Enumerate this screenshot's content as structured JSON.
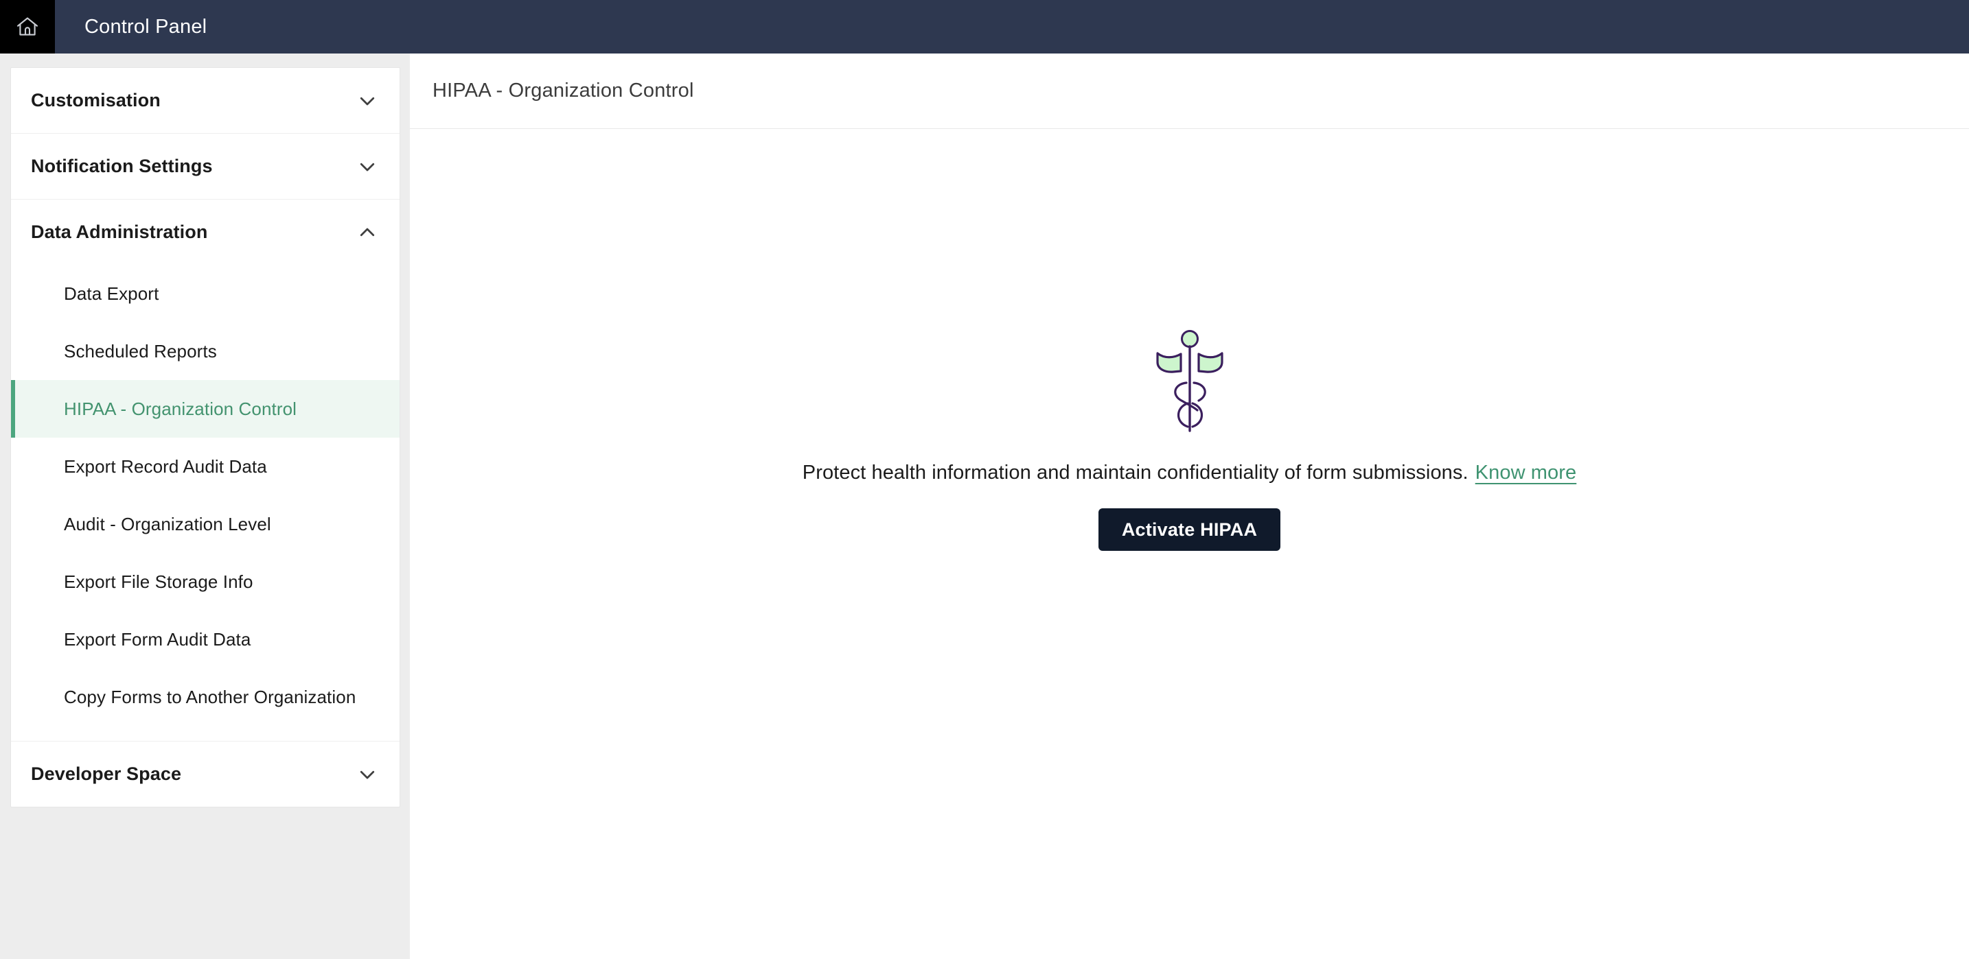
{
  "topbar": {
    "home_icon": "home-icon",
    "title": "Control Panel"
  },
  "sidebar": {
    "sections": [
      {
        "label": "Customisation",
        "expanded": false,
        "chevron": "chevron-down-icon",
        "items": []
      },
      {
        "label": "Notification Settings",
        "expanded": false,
        "chevron": "chevron-down-icon",
        "items": []
      },
      {
        "label": "Data Administration",
        "expanded": true,
        "chevron": "chevron-up-icon",
        "items": [
          {
            "label": "Data Export",
            "active": false
          },
          {
            "label": "Scheduled Reports",
            "active": false
          },
          {
            "label": "HIPAA - Organization Control",
            "active": true
          },
          {
            "label": "Export Record Audit Data",
            "active": false
          },
          {
            "label": "Audit - Organization Level",
            "active": false
          },
          {
            "label": "Export File Storage Info",
            "active": false
          },
          {
            "label": "Export Form Audit Data",
            "active": false
          },
          {
            "label": "Copy Forms to Another Organization",
            "active": false
          }
        ]
      },
      {
        "label": "Developer Space",
        "expanded": false,
        "chevron": "chevron-down-icon",
        "items": []
      }
    ]
  },
  "main": {
    "title": "HIPAA - Organization Control",
    "empty_state": {
      "icon": "caduceus-icon",
      "message": "Protect health information and maintain confidentiality of form submissions.",
      "link_label": "Know more",
      "button_label": "Activate HIPAA"
    }
  },
  "colors": {
    "topbar_bg": "#2e3850",
    "home_cell_bg": "#000000",
    "sidebar_bg": "#ededed",
    "card_bg": "#ffffff",
    "accent_green": "#43936f",
    "active_item_bg": "#eef7f2",
    "active_item_border": "#4ca67f",
    "link_green": "#3f9371",
    "button_bg": "#101a2b",
    "icon_outline": "#3b1f5e",
    "icon_fill": "#cdf5cd",
    "text_primary": "#1b1b1b",
    "title_text": "#3c3c3c"
  }
}
